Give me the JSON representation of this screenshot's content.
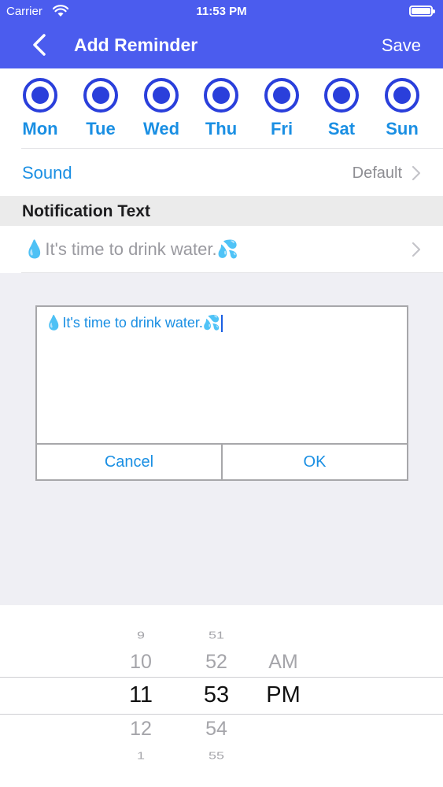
{
  "status_bar": {
    "carrier": "Carrier",
    "time": "11:53 PM"
  },
  "nav": {
    "title": "Add Reminder",
    "save_label": "Save",
    "back_icon": "chevron-left-icon"
  },
  "days": [
    {
      "label": "Mon",
      "selected": true
    },
    {
      "label": "Tue",
      "selected": true
    },
    {
      "label": "Wed",
      "selected": true
    },
    {
      "label": "Thu",
      "selected": true
    },
    {
      "label": "Fri",
      "selected": true
    },
    {
      "label": "Sat",
      "selected": true
    },
    {
      "label": "Sun",
      "selected": true
    }
  ],
  "sound": {
    "label": "Sound",
    "value": "Default"
  },
  "notification": {
    "section_title": "Notification Text",
    "text": "💧It's time to drink water.💦"
  },
  "dialog": {
    "text": "💧It's time to drink water.💦",
    "cancel_label": "Cancel",
    "ok_label": "OK"
  },
  "picker": {
    "hours": [
      "9",
      "10",
      "11",
      "12",
      "1"
    ],
    "minutes": [
      "51",
      "52",
      "53",
      "54",
      "55"
    ],
    "periods": [
      "AM",
      "PM"
    ],
    "selected": {
      "hour": "11",
      "minute": "53",
      "period": "PM"
    }
  },
  "colors": {
    "header": "#4b5cee",
    "accent": "#1a8fe3",
    "radio": "#2a3fdb"
  }
}
